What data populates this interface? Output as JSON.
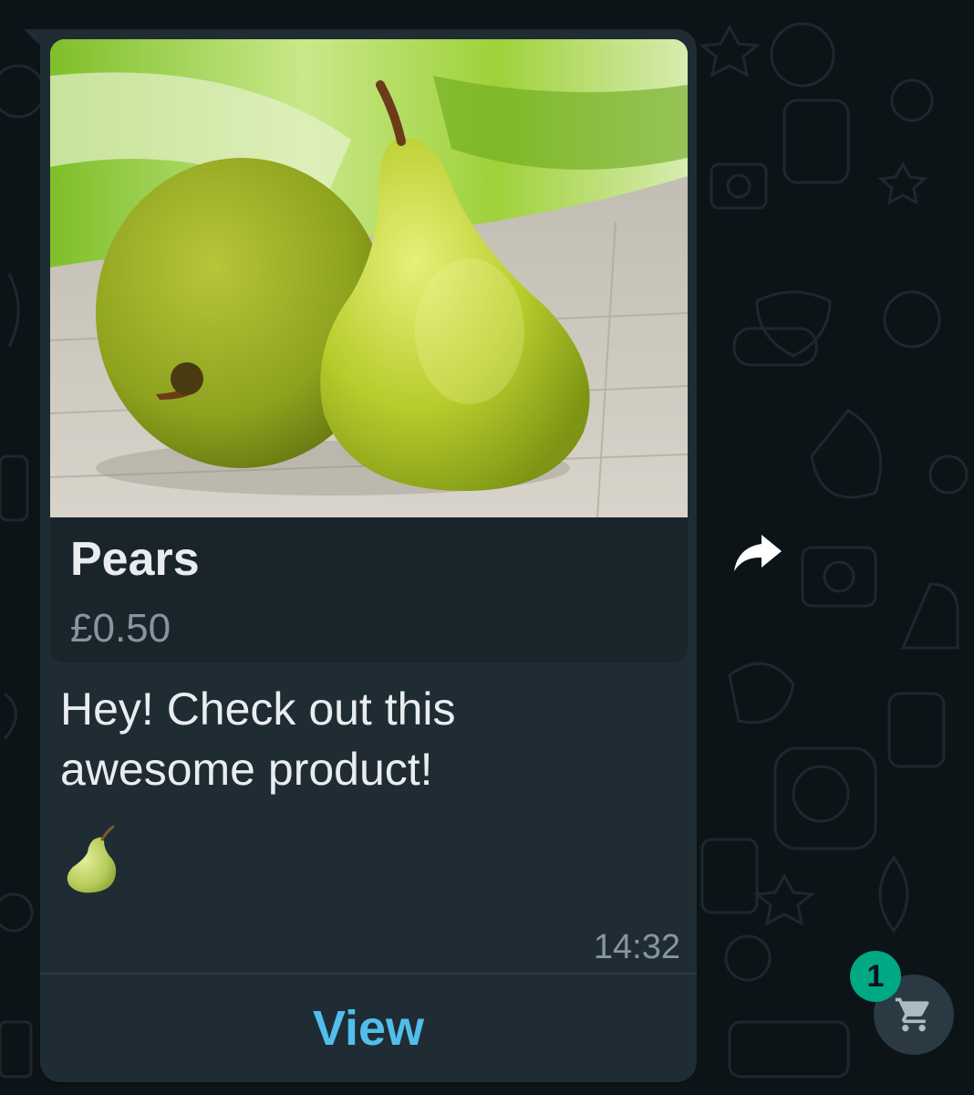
{
  "product": {
    "name": "Pears",
    "price": "£0.50",
    "image_alt": "Two green pears on a wooden table"
  },
  "message": {
    "text": "Hey! Check out this\nawesome product!",
    "emoji": "pear-emoji",
    "time": "14:32"
  },
  "actions": {
    "view_label": "View",
    "forward_icon": "forward-arrow-icon"
  },
  "cart": {
    "icon": "shopping-cart-icon",
    "count": "1"
  },
  "colors": {
    "chat_background": "#0d1418",
    "bubble": "#1f2c34",
    "card": "#1a252b",
    "primary_text": "#e9edef",
    "secondary_text": "#8696a0",
    "link": "#53bdeb",
    "badge": "#00a884"
  }
}
